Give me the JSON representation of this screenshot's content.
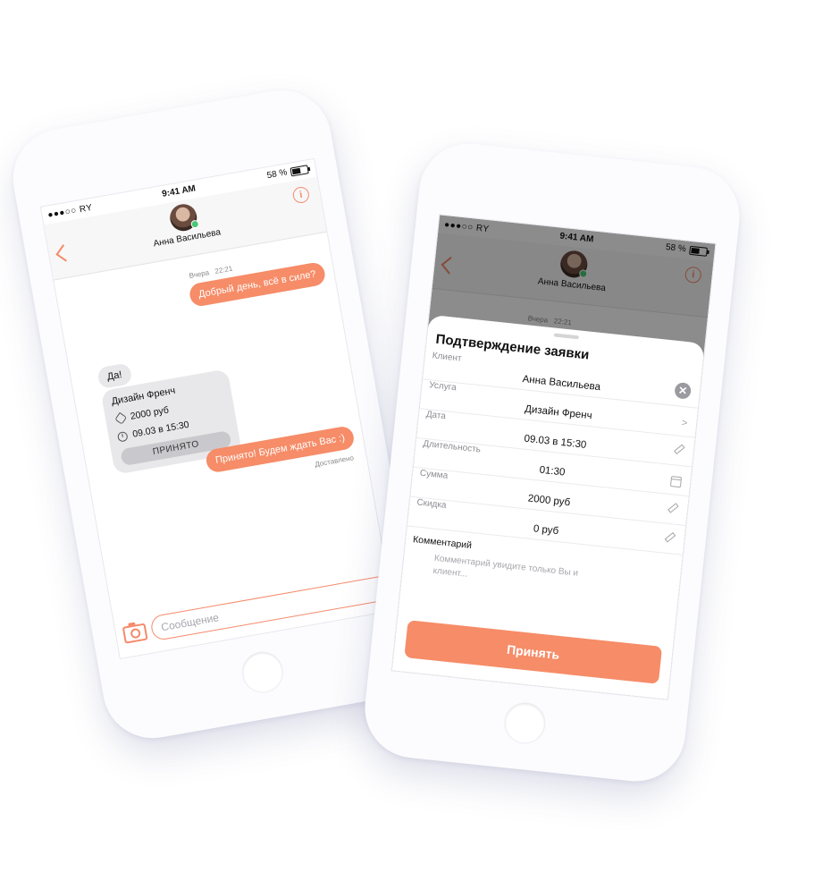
{
  "colors": {
    "accent": "#f68c68",
    "online": "#48c774"
  },
  "status_bar": {
    "carrier": "●●●○○ RY",
    "time": "9:41 AM",
    "battery": "58 %"
  },
  "chat": {
    "contact_name": "Анна Васильева",
    "timestamp_day": "Вчера",
    "timestamp_time": "22:21",
    "messages": {
      "out_1": "Добрый день, всё в силе?",
      "in_1": "Да!",
      "card_title": "Дизайн Френч",
      "card_price": "2000 руб",
      "card_datetime": "09.03 в 15:30",
      "card_button": "ПРИНЯТО",
      "out_2": "Принято! Будем ждать Вас :)",
      "delivered": "Доставлено"
    },
    "input_placeholder": "Сообщение"
  },
  "confirm": {
    "title": "Подтверждение заявки",
    "fields": [
      {
        "label": "Клиент",
        "value": "Анна Васильева",
        "icon": "none"
      },
      {
        "label": "Услуга",
        "value": "Дизайн Френч",
        "icon": "chevron-right-icon"
      },
      {
        "label": "Дата",
        "value": "09.03 в 15:30",
        "icon": "pencil-icon"
      },
      {
        "label": "Длительность",
        "value": "01:30",
        "icon": "calendar-icon"
      },
      {
        "label": "Сумма",
        "value": "2000 руб",
        "icon": "pencil-icon"
      },
      {
        "label": "Скидка",
        "value": "0 руб",
        "icon": "pencil-icon"
      }
    ],
    "comment_label": "Комментарий",
    "comment_placeholder": "Комментарий увидите только Вы и клиент...",
    "accept_label": "Принять"
  }
}
